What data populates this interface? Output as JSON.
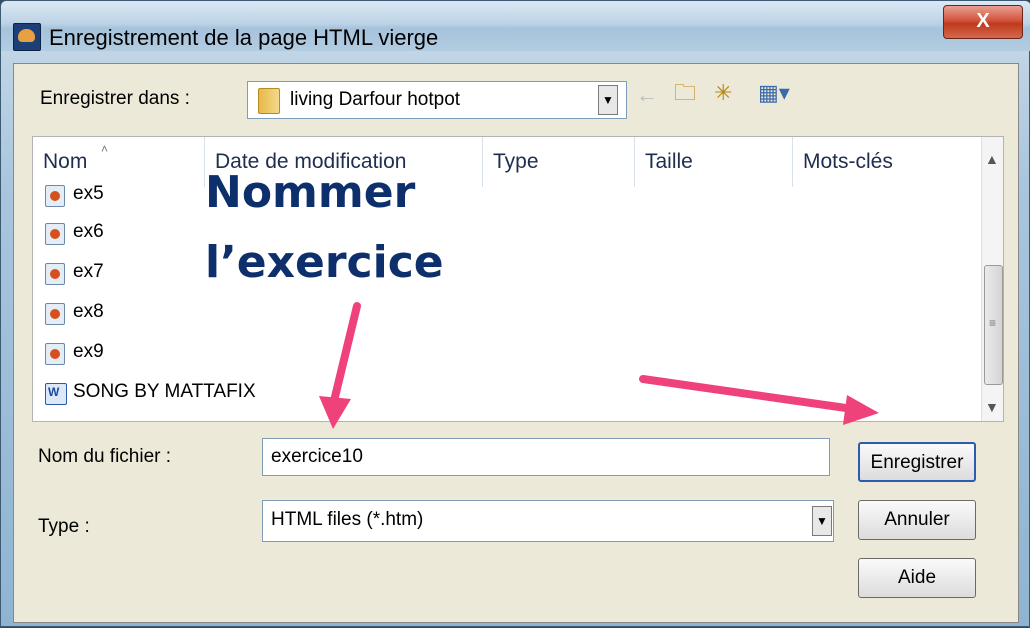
{
  "window": {
    "title": "Enregistrement de la page HTML vierge",
    "close_label": "X"
  },
  "toolbar": {
    "lookin_label": "Enregistrer dans :",
    "lookin_value": "living Darfour hotpot",
    "icons": [
      "folder-icon",
      "back-arrow-icon",
      "up-folder-icon",
      "new-folder-icon",
      "views-menu-icon"
    ]
  },
  "filelist": {
    "columns": [
      "Nom",
      "Date de modification",
      "Type",
      "Taille",
      "Mots-clés"
    ],
    "items": [
      "ex5",
      "ex6",
      "ex7",
      "ex8",
      "ex9",
      "SONG BY MATTAFIX"
    ]
  },
  "annotation": {
    "line1": "Nommer",
    "line2": "l’exercice",
    "arrow_color": "#f0427a"
  },
  "form": {
    "filename_label": "Nom du fichier :",
    "filename_value": "exercice10",
    "type_label": "Type :",
    "type_value": "HTML files (*.htm)"
  },
  "buttons": {
    "save": "Enregistrer",
    "cancel": "Annuler",
    "help": "Aide"
  }
}
